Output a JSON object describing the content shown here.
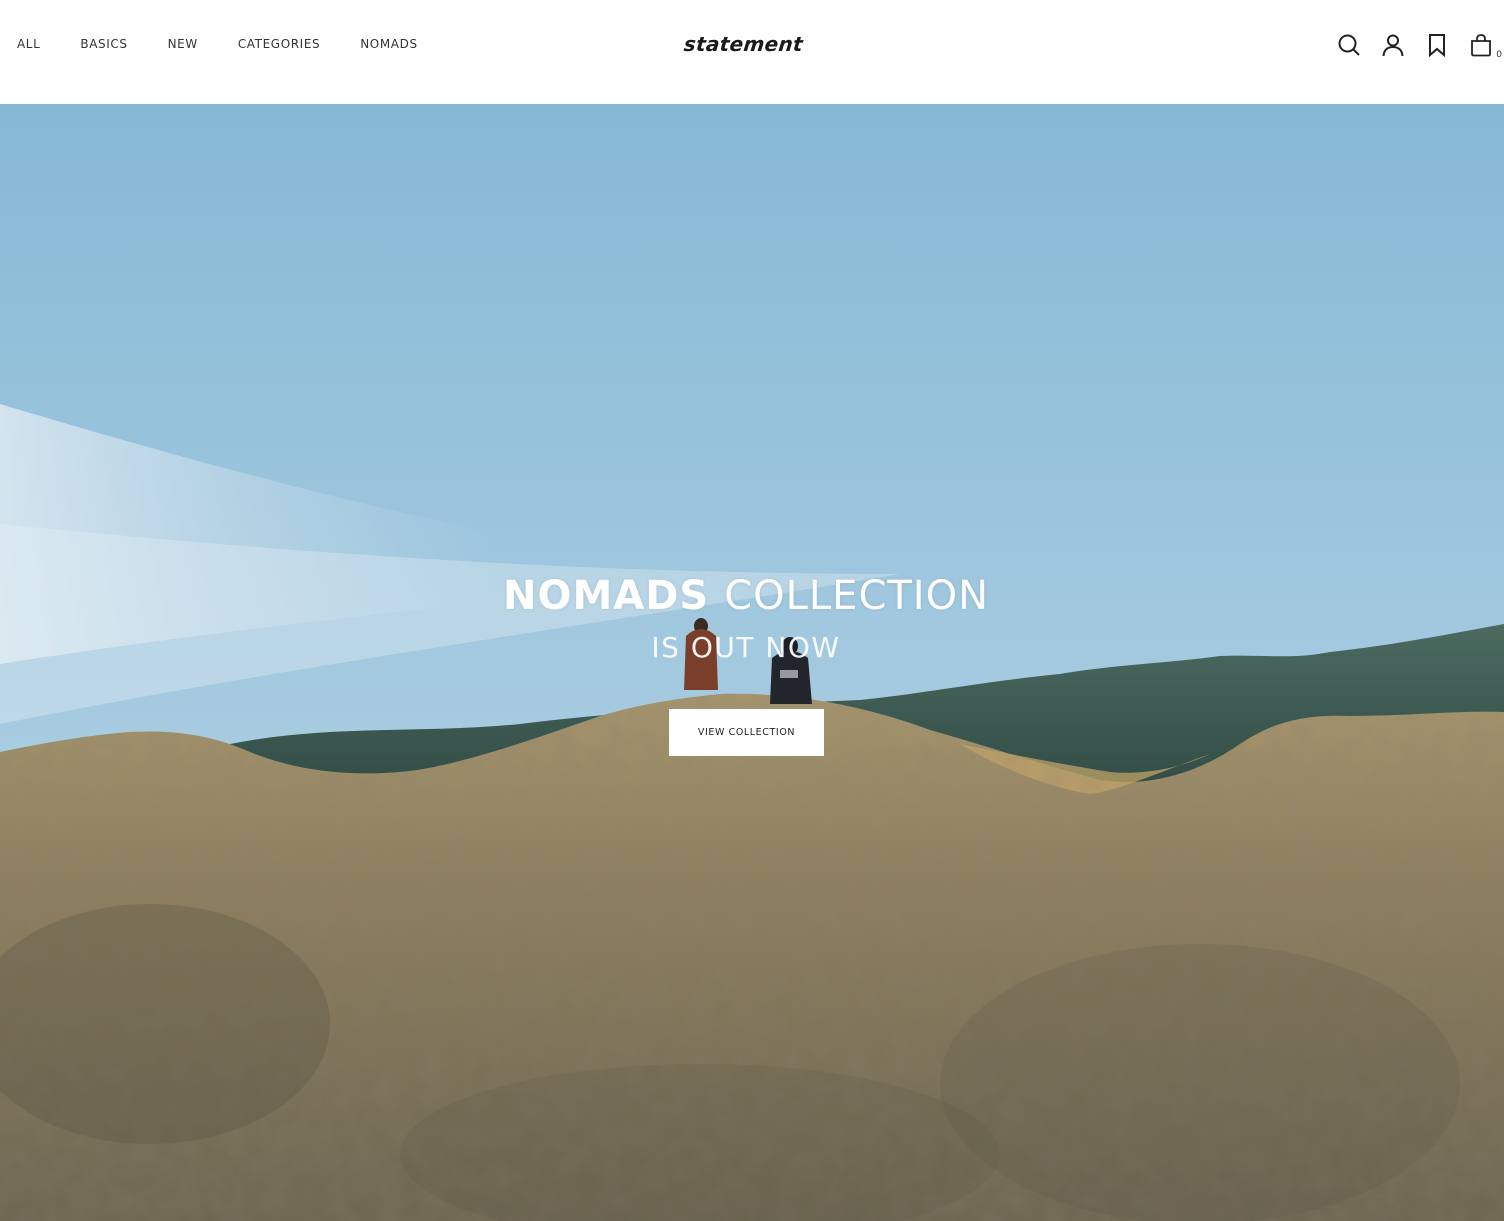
{
  "header": {
    "nav": [
      {
        "label": "ALL"
      },
      {
        "label": "BASICS"
      },
      {
        "label": "NEW"
      },
      {
        "label": "CATEGORIES"
      },
      {
        "label": "NOMADS"
      }
    ],
    "logo": "statement",
    "icons": [
      "search-icon",
      "account-icon",
      "bookmark-icon",
      "bag-icon"
    ],
    "cart_count": "0"
  },
  "hero": {
    "title_bold": "NOMADS",
    "title_light": "COLLECTION",
    "subtitle": "IS OUT NOW",
    "cta_label": "VIEW COLLECTION"
  },
  "colors": {
    "header_bg": "#ffffff",
    "text": "#333333",
    "sky_top": "#8dbbd6",
    "sky_bottom": "#cfe3ee",
    "rock": "#8f7f5c",
    "hills": "#3d5a4e",
    "button_bg": "#ffffff"
  }
}
